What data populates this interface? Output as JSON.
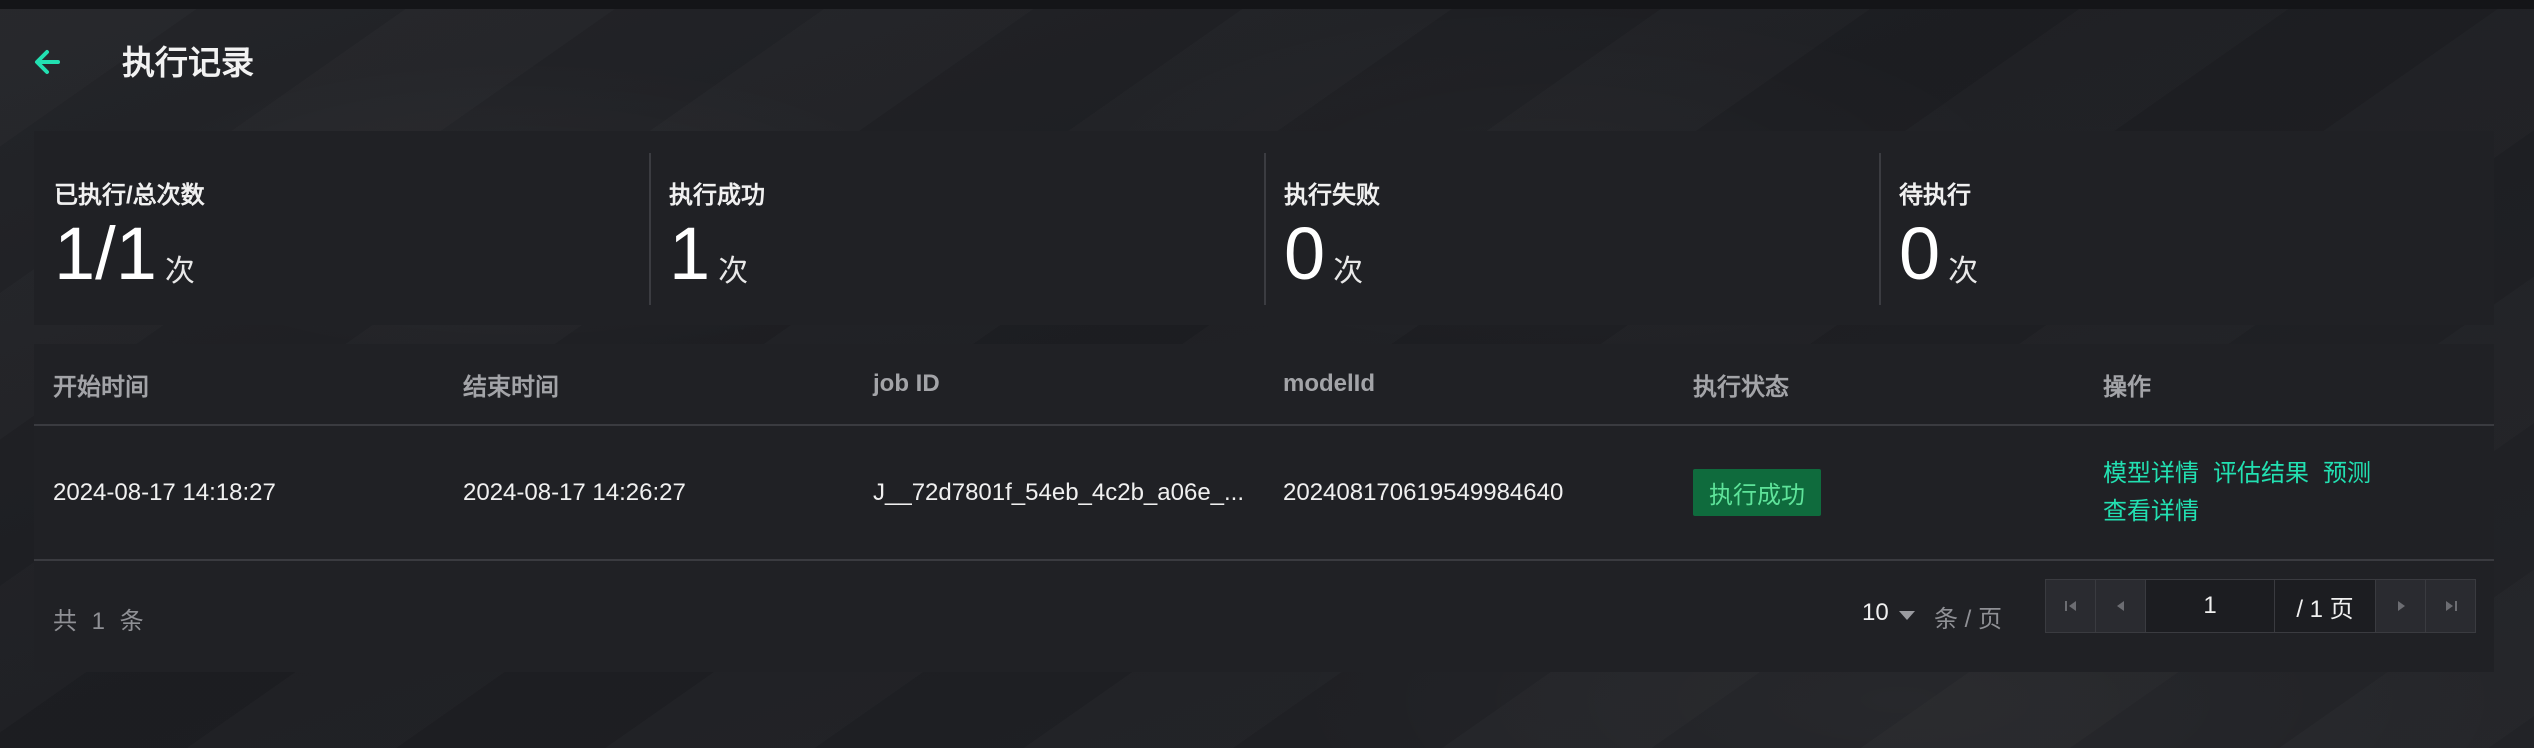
{
  "header": {
    "title": "执行记录"
  },
  "stats": [
    {
      "label": "已执行/总次数",
      "value": "1/1",
      "unit": "次"
    },
    {
      "label": "执行成功",
      "value": "1",
      "unit": "次"
    },
    {
      "label": "执行失败",
      "value": "0",
      "unit": "次"
    },
    {
      "label": "待执行",
      "value": "0",
      "unit": "次"
    }
  ],
  "table": {
    "columns": [
      "开始时间",
      "结束时间",
      "job ID",
      "modelId",
      "执行状态",
      "操作"
    ],
    "rows": [
      {
        "start_time": "2024-08-17 14:18:27",
        "end_time": "2024-08-17 14:26:27",
        "job_id": "J__72d7801f_54eb_4c2b_a06e_...",
        "model_id": "20240817061954998464​0",
        "status": "执行成功",
        "actions": [
          "模型详情",
          "评估结果",
          "预测",
          "查看详情"
        ]
      }
    ]
  },
  "pagination": {
    "total_text": "共 1 条",
    "page_size": "10",
    "per_page_label": "条 / 页",
    "current_page": "1",
    "total_pages_text": "/ 1 页"
  },
  "colors": {
    "accent": "#22e0b1",
    "success_bg": "#0f6b3d",
    "success_text": "#5ee39a",
    "panel": "#202125"
  }
}
